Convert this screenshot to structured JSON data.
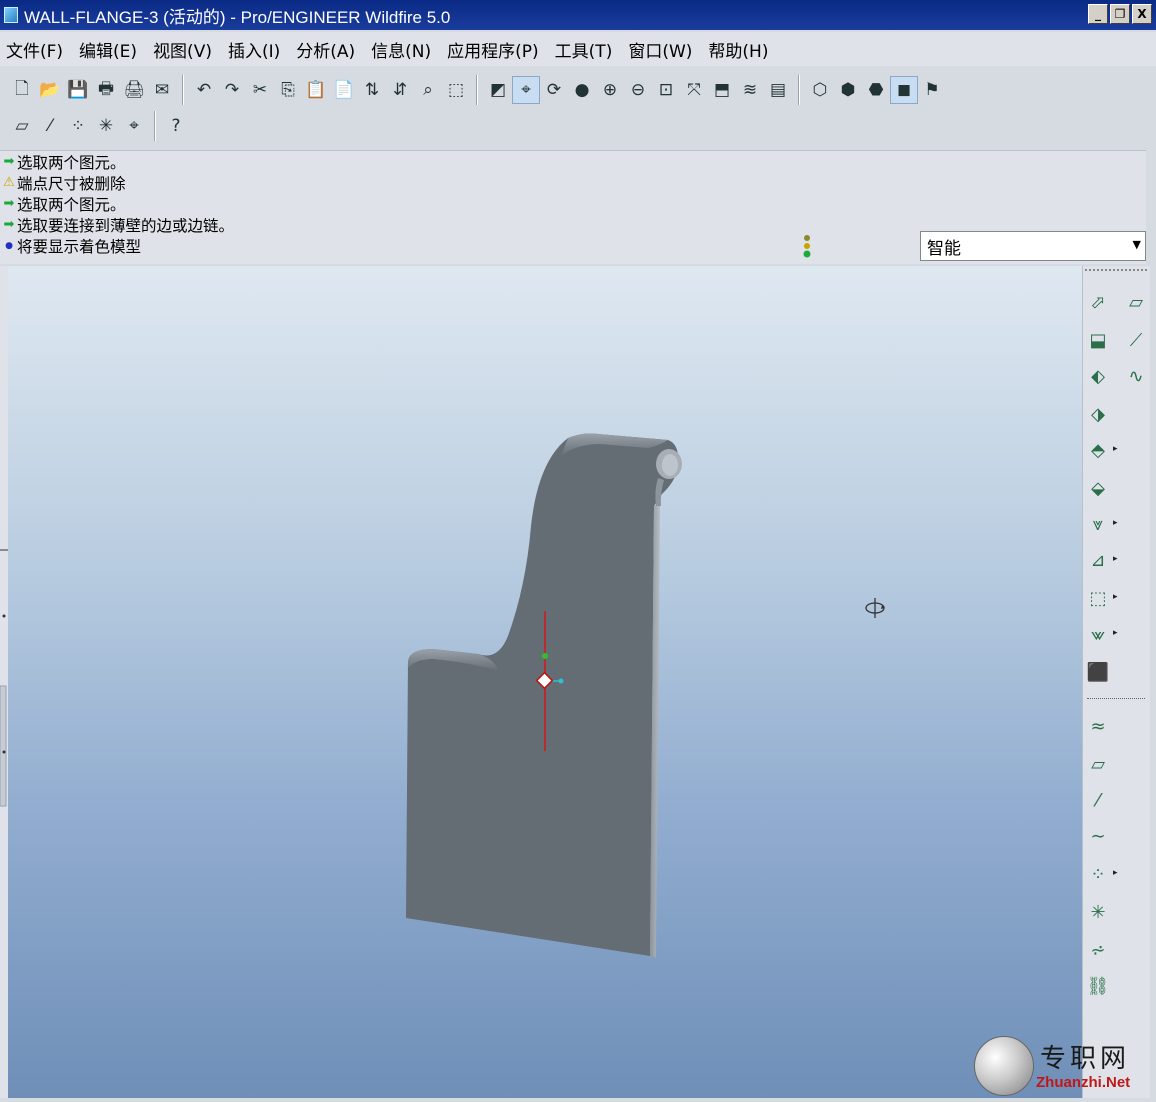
{
  "window": {
    "title": "WALL-FLANGE-3 (活动的) - Pro/ENGINEER Wildfire 5.0",
    "buttons": [
      "_",
      "❐",
      "X"
    ]
  },
  "menu": [
    {
      "label": "文件(F)"
    },
    {
      "label": "编辑(E)"
    },
    {
      "label": "视图(V)"
    },
    {
      "label": "插入(I)"
    },
    {
      "label": "分析(A)"
    },
    {
      "label": "信息(N)"
    },
    {
      "label": "应用程序(P)"
    },
    {
      "label": "工具(T)"
    },
    {
      "label": "窗口(W)"
    },
    {
      "label": "帮助(H)"
    }
  ],
  "toolbar1": [
    {
      "icon": "new-icon",
      "glyph": "🗋"
    },
    {
      "icon": "open-icon",
      "glyph": "📂"
    },
    {
      "icon": "save-icon",
      "glyph": "💾"
    },
    {
      "icon": "print-icon",
      "glyph": "🖶"
    },
    {
      "icon": "print-preview-icon",
      "glyph": "🖨"
    },
    {
      "icon": "email-icon",
      "glyph": "✉"
    },
    {
      "sep": true
    },
    {
      "icon": "undo-icon",
      "glyph": "↶"
    },
    {
      "icon": "redo-icon",
      "glyph": "↷"
    },
    {
      "icon": "cut-icon",
      "glyph": "✂"
    },
    {
      "icon": "copy-icon",
      "glyph": "⎘"
    },
    {
      "icon": "paste-icon",
      "glyph": "📋"
    },
    {
      "icon": "paste-special-icon",
      "glyph": "📄"
    },
    {
      "icon": "regenerate-icon",
      "glyph": "⇅"
    },
    {
      "icon": "regen-manager-icon",
      "glyph": "⇵"
    },
    {
      "icon": "find-icon",
      "glyph": "⌕"
    },
    {
      "icon": "select-box-icon",
      "glyph": "⬚"
    },
    {
      "sep": true
    },
    {
      "icon": "repaint-icon",
      "glyph": "◩"
    },
    {
      "icon": "spin-center-icon",
      "glyph": "⌖",
      "active": true
    },
    {
      "icon": "orient-mode-icon",
      "glyph": "⟳"
    },
    {
      "icon": "shading-icon",
      "glyph": "●"
    },
    {
      "icon": "zoom-in-icon",
      "glyph": "⊕"
    },
    {
      "icon": "zoom-out-icon",
      "glyph": "⊖"
    },
    {
      "icon": "refit-icon",
      "glyph": "⊡"
    },
    {
      "icon": "reorient-icon",
      "glyph": "⤧"
    },
    {
      "icon": "saved-views-icon",
      "glyph": "⬒"
    },
    {
      "icon": "layers-icon",
      "glyph": "≋"
    },
    {
      "icon": "view-manager-icon",
      "glyph": "▤"
    },
    {
      "sep": true
    },
    {
      "icon": "wireframe-icon",
      "glyph": "⬡"
    },
    {
      "icon": "hidden-line-icon",
      "glyph": "⬢"
    },
    {
      "icon": "no-hidden-icon",
      "glyph": "⬣"
    },
    {
      "icon": "shaded-icon",
      "glyph": "◼",
      "active": true
    },
    {
      "icon": "model-tree-icon",
      "glyph": "⚑"
    }
  ],
  "toolbar2": [
    {
      "icon": "datum-plane-display-icon",
      "glyph": "▱"
    },
    {
      "icon": "datum-axis-display-icon",
      "glyph": "⁄"
    },
    {
      "icon": "datum-point-display-icon",
      "glyph": "⁘"
    },
    {
      "icon": "coord-sys-display-icon",
      "glyph": "✳"
    },
    {
      "icon": "annotation-display-icon",
      "glyph": "⌖"
    },
    {
      "sep": true
    },
    {
      "icon": "context-help-icon",
      "glyph": "?"
    }
  ],
  "messages": [
    {
      "type": "arrow",
      "text": "选取两个图元。"
    },
    {
      "type": "warn",
      "text": "端点尺寸被删除"
    },
    {
      "type": "arrow",
      "text": "选取两个图元。"
    },
    {
      "type": "arrow",
      "text": "选取要连接到薄壁的边或边链。"
    },
    {
      "type": "dot",
      "text": "将要显示着色模型"
    }
  ],
  "filter": {
    "value": "智能"
  },
  "watermark": {
    "cn": "专职网",
    "en": "Zhuanzhi.Net"
  }
}
